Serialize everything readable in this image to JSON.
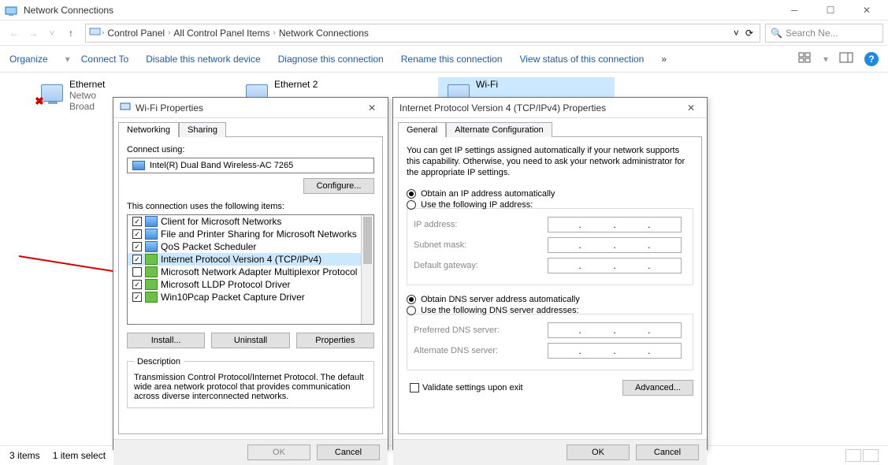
{
  "window": {
    "title": "Network Connections",
    "breadcrumbs": [
      "Control Panel",
      "All Control Panel Items",
      "Network Connections"
    ],
    "search_placeholder": "Search Ne...",
    "commands": {
      "organize": "Organize",
      "connect": "Connect To",
      "disable": "Disable this network device",
      "diagnose": "Diagnose this connection",
      "rename": "Rename this connection",
      "viewstatus": "View status of this connection"
    },
    "chevrons": "»"
  },
  "adapters": {
    "a1": {
      "name": "Ethernet",
      "l2": "Netwo",
      "l3": "Broad"
    },
    "a2": {
      "name": "Ethernet 2",
      "l2": "",
      "l3": ""
    },
    "a3": {
      "name": "Wi-Fi",
      "l2": "",
      "l3": ""
    }
  },
  "status": {
    "items": "3 items",
    "sel": "1 item select"
  },
  "wifi_props": {
    "title": "Wi-Fi Properties",
    "tab1": "Networking",
    "tab2": "Sharing",
    "connect_using": "Connect using:",
    "adapter": "Intel(R) Dual Band Wireless-AC 7265",
    "configure": "Configure...",
    "items_label": "This connection uses the following items:",
    "items": [
      {
        "c": true,
        "t": "mon",
        "n": "Client for Microsoft Networks"
      },
      {
        "c": true,
        "t": "mon",
        "n": "File and Printer Sharing for Microsoft Networks"
      },
      {
        "c": true,
        "t": "mon",
        "n": "QoS Packet Scheduler"
      },
      {
        "c": true,
        "t": "svc",
        "n": "Internet Protocol Version 4 (TCP/IPv4)",
        "sel": true
      },
      {
        "c": false,
        "t": "svc",
        "n": "Microsoft Network Adapter Multiplexor Protocol"
      },
      {
        "c": true,
        "t": "svc",
        "n": "Microsoft LLDP Protocol Driver"
      },
      {
        "c": true,
        "t": "svc",
        "n": "Win10Pcap Packet Capture Driver"
      }
    ],
    "install": "Install...",
    "uninstall": "Uninstall",
    "properties": "Properties",
    "desc_h": "Description",
    "desc": "Transmission Control Protocol/Internet Protocol. The default wide area network protocol that provides communication across diverse interconnected networks.",
    "ok": "OK",
    "cancel": "Cancel"
  },
  "tcp": {
    "title": "Internet Protocol Version 4 (TCP/IPv4) Properties",
    "tab1": "General",
    "tab2": "Alternate Configuration",
    "blurb": "You can get IP settings assigned automatically if your network supports this capability. Otherwise, you need to ask your network administrator for the appropriate IP settings.",
    "r1": "Obtain an IP address automatically",
    "r2": "Use the following IP address:",
    "ip": "IP address:",
    "mask": "Subnet mask:",
    "gw": "Default gateway:",
    "r3": "Obtain DNS server address automatically",
    "r4": "Use the following DNS server addresses:",
    "pdns": "Preferred DNS server:",
    "adns": "Alternate DNS server:",
    "validate": "Validate settings upon exit",
    "advanced": "Advanced...",
    "ok": "OK",
    "cancel": "Cancel"
  }
}
